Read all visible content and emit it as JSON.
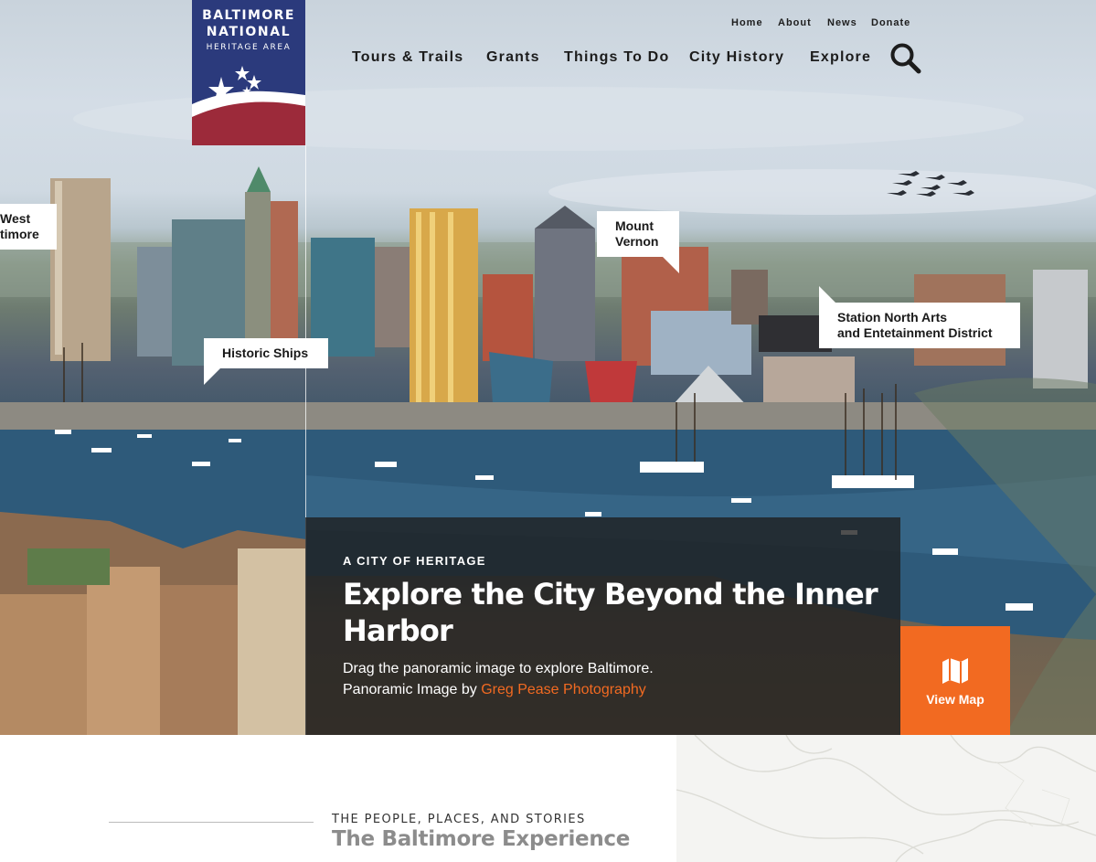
{
  "logo": {
    "line1": "BALTIMORE",
    "line2": "NATIONAL",
    "line3": "HERITAGE AREA"
  },
  "top_nav": [
    "Home",
    "About",
    "News",
    "Donate"
  ],
  "main_nav": [
    "Tours & Trails",
    "Grants",
    "Things To Do",
    "City History",
    "Explore"
  ],
  "map_labels": {
    "west": "West\ntimore",
    "historic_ships": "Historic Ships",
    "mount_vernon": "Mount\nVernon",
    "station_north": "Station North Arts\nand Entetainment District"
  },
  "hero": {
    "eyebrow": "A CITY OF HERITAGE",
    "headline": "Explore the City Beyond the Inner Harbor",
    "description": "Drag the panoramic image to explore Baltimore.",
    "credit_prefix": "Panoramic Image by ",
    "credit_link": "Greg Pease Photography",
    "view_map": "View Map"
  },
  "section": {
    "kicker": "THE PEOPLE, PLACES, AND STORIES",
    "title": "The Baltimore Experience"
  },
  "icons": [
    "search-icon",
    "map-icon",
    "stars-icon"
  ],
  "colors": {
    "logo_blue": "#2b3a7c",
    "logo_red": "#9c2a3a",
    "accent_orange": "#f26a21",
    "caption_bg": "#1e1e1e"
  }
}
